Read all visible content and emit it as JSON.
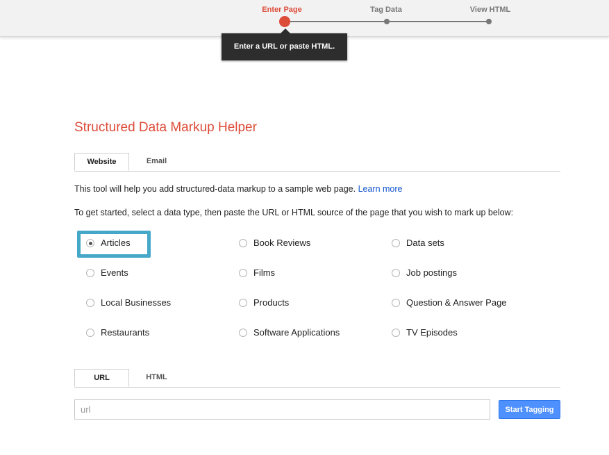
{
  "steps": [
    {
      "label": "Enter Page",
      "active": true
    },
    {
      "label": "Tag Data",
      "active": false
    },
    {
      "label": "View HTML",
      "active": false
    }
  ],
  "tooltip": "Enter a URL or paste HTML.",
  "title": "Structured Data Markup Helper",
  "source_tabs": [
    {
      "label": "Website",
      "selected": true
    },
    {
      "label": "Email",
      "selected": false
    }
  ],
  "intro_text": "This tool will help you add structured-data markup to a sample web page.",
  "learn_more": "Learn more",
  "instructions": "To get started, select a data type, then paste the URL or HTML source of the page that you wish to mark up below:",
  "data_types": [
    {
      "label": "Articles",
      "checked": true
    },
    {
      "label": "Book Reviews",
      "checked": false
    },
    {
      "label": "Data sets",
      "checked": false
    },
    {
      "label": "Events",
      "checked": false
    },
    {
      "label": "Films",
      "checked": false
    },
    {
      "label": "Job postings",
      "checked": false
    },
    {
      "label": "Local Businesses",
      "checked": false
    },
    {
      "label": "Products",
      "checked": false
    },
    {
      "label": "Question & Answer Page",
      "checked": false
    },
    {
      "label": "Restaurants",
      "checked": false
    },
    {
      "label": "Software Applications",
      "checked": false
    },
    {
      "label": "TV Episodes",
      "checked": false
    }
  ],
  "input_tabs": [
    {
      "label": "URL",
      "selected": true
    },
    {
      "label": "HTML",
      "selected": false
    }
  ],
  "url_input": {
    "placeholder": "url",
    "value": ""
  },
  "start_button": "Start Tagging",
  "colors": {
    "accent": "#dd4b39",
    "link": "#1155cc",
    "button": "#4d90fe",
    "highlight": "#45a8c8"
  }
}
